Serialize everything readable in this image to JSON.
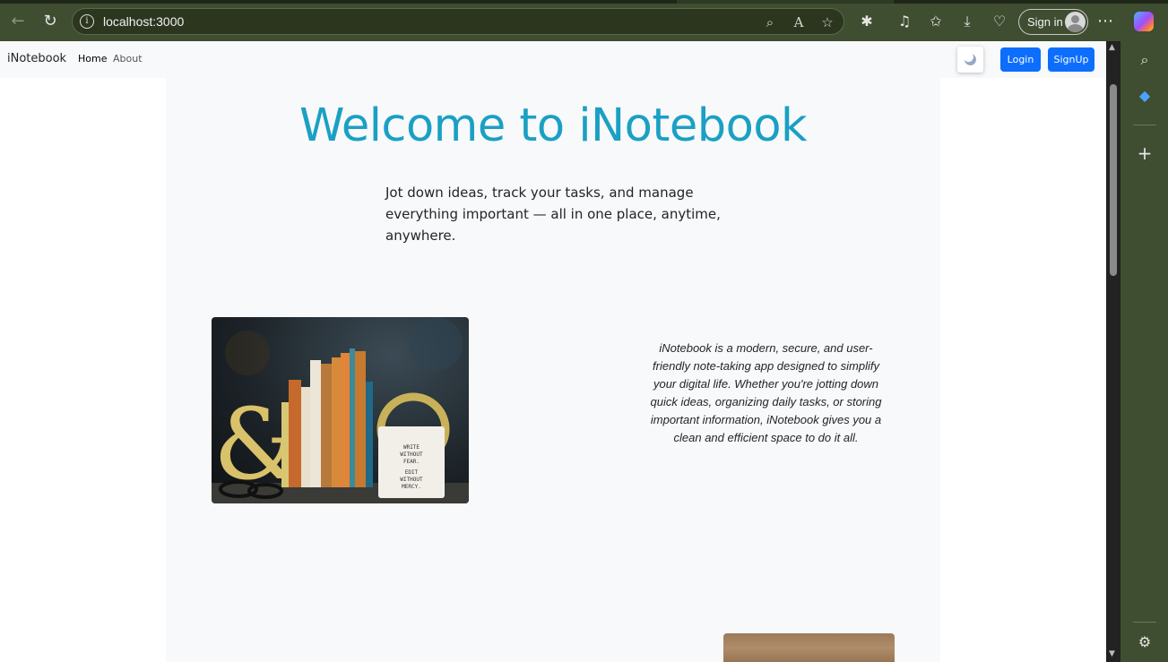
{
  "browser": {
    "url": "localhost:3000",
    "signin_label": "Sign in"
  },
  "navbar": {
    "brand": "iNotebook",
    "links": [
      {
        "label": "Home",
        "active": true
      },
      {
        "label": "About",
        "active": false
      }
    ],
    "login_label": "Login",
    "signup_label": "SignUp"
  },
  "hero": {
    "title": "Welcome to iNotebook",
    "subtitle": "Jot down ideas, track your tasks, and manage everything important — all in one place, anytime, anywhere."
  },
  "about": {
    "text": "iNotebook is a modern, secure, and user-friendly note-taking app designed to simplify your digital life. Whether you're jotting down quick ideas, organizing daily tasks, or storing important information, iNotebook gives you a clean and efficient space to do it all."
  },
  "photo_mug_text": "WRITE WITHOUT FEAR. EDIT WITHOUT MERCY.",
  "colors": {
    "title": "#1aa0c4",
    "primary_button": "#0d6efd",
    "chrome": "#3f4d30"
  }
}
